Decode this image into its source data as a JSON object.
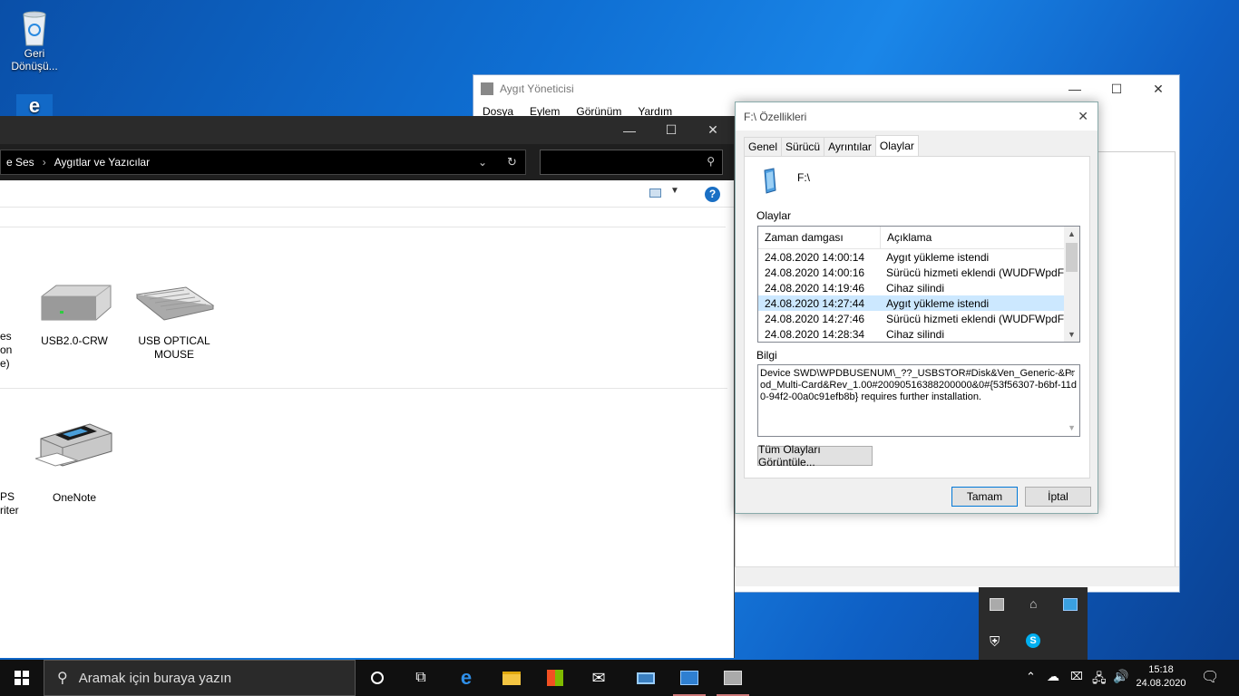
{
  "desktop": {
    "recycle_bin_label": "Geri\nDönüşü..."
  },
  "device_manager": {
    "title": "Aygıt Yöneticisi",
    "menu": [
      "Dosya",
      "Eylem",
      "Görünüm",
      "Yardım"
    ]
  },
  "explorer": {
    "breadcrumb_prev": "e Ses",
    "breadcrumb_current": "Aygıtlar ve Yazıcılar",
    "devices": [
      {
        "label": "USB2.0-CRW"
      },
      {
        "label": "USB OPTICAL MOUSE"
      },
      {
        "label": "OneNote"
      }
    ],
    "partial_labels": {
      "row1": [
        "es",
        "on",
        "e)"
      ],
      "row2": [
        "PS",
        "riter"
      ]
    }
  },
  "properties": {
    "title": "F:\\ Özellikleri",
    "tabs": [
      "Genel",
      "Sürücü",
      "Ayrıntılar",
      "Olaylar"
    ],
    "active_tab": "Olaylar",
    "device_name": "F:\\",
    "events_label": "Olaylar",
    "columns": [
      "Zaman damgası",
      "Açıklama"
    ],
    "events": [
      {
        "time": "24.08.2020 14:00:14",
        "desc": "Aygıt yükleme istendi"
      },
      {
        "time": "24.08.2020 14:00:16",
        "desc": "Sürücü hizmeti eklendi (WUDFWpdFs)"
      },
      {
        "time": "24.08.2020 14:19:46",
        "desc": "Cihaz silindi"
      },
      {
        "time": "24.08.2020 14:27:44",
        "desc": "Aygıt yükleme istendi"
      },
      {
        "time": "24.08.2020 14:27:46",
        "desc": "Sürücü hizmeti eklendi (WUDFWpdFs)"
      },
      {
        "time": "24.08.2020 14:28:34",
        "desc": "Cihaz silindi"
      }
    ],
    "selected_index": 3,
    "info_label": "Bilgi",
    "info_text": "Device SWD\\WPDBUSENUM\\_??_USBSTOR#Disk&Ven_Generic-&Prod_Multi-Card&Rev_1.00#20090516388200000&0#{53f56307-b6bf-11d0-94f2-00a0c91efb8b} requires further installation.",
    "view_all_button": "Tüm Olayları Görüntüle...",
    "ok_button": "Tamam",
    "cancel_button": "İptal"
  },
  "taskbar": {
    "search_placeholder": "Aramak için buraya yazın",
    "time": "15:18",
    "date": "24.08.2020"
  },
  "colors": {
    "selection": "#cce8ff",
    "accent": "#0078d7"
  }
}
